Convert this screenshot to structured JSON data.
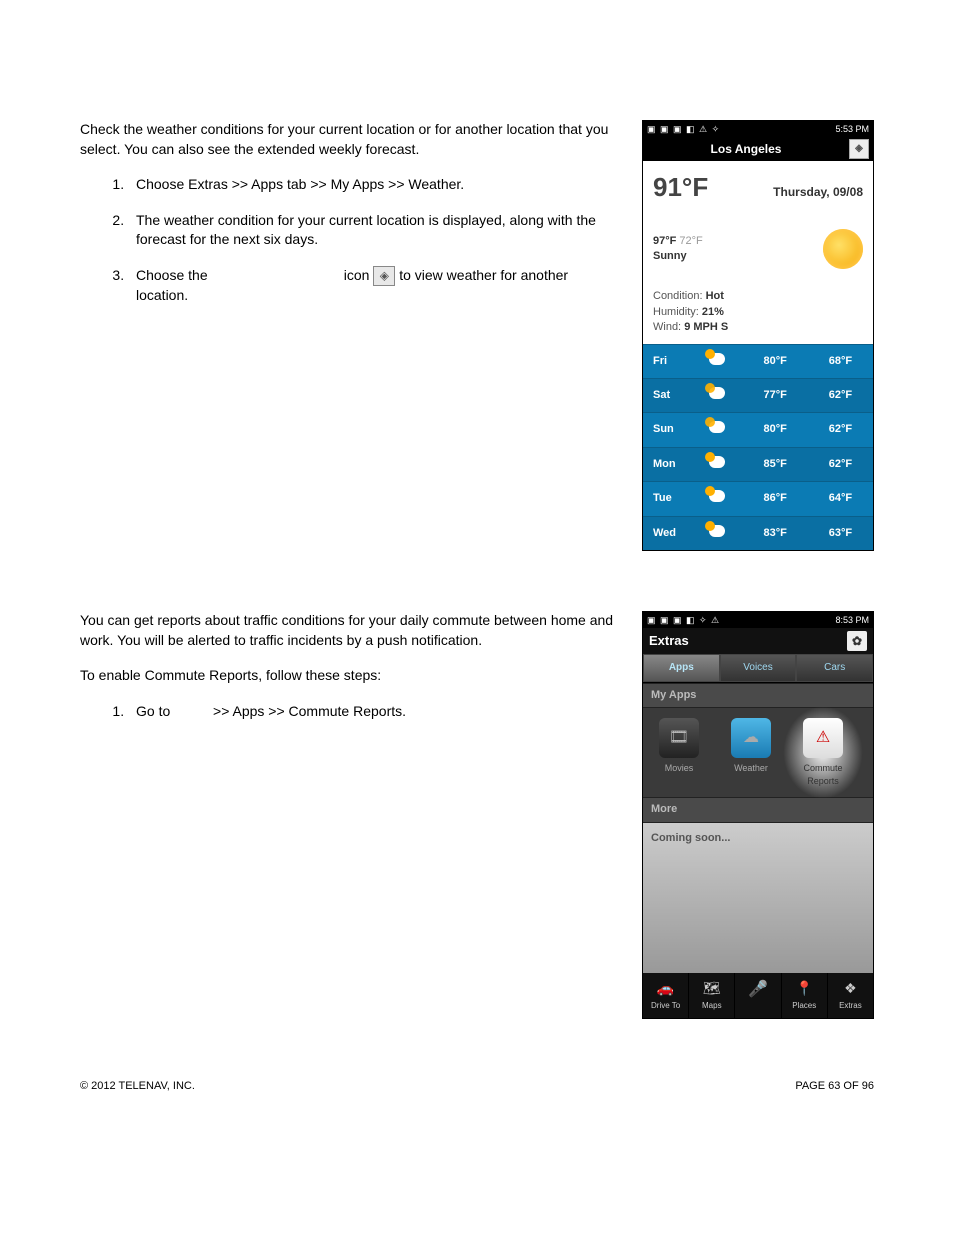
{
  "intro1": "Check the weather conditions for your current location or for another location that you select. You can also see the extended weekly forecast.",
  "steps1": [
    "Choose Extras >> Apps tab >> My Apps >> Weather.",
    "The weather condition for your current location is displayed, along with the forecast for the next six days."
  ],
  "step3_a": "Choose the",
  "step3_b": "icon",
  "step3_c": "to view weather for another location.",
  "phone1": {
    "time": "5:53 PM",
    "title": "Los Angeles",
    "temp": "91°F",
    "date": "Thursday, 09/08",
    "hi": "97°F",
    "lo": "72°F",
    "cond": "Sunny",
    "stat_cond_lbl": "Condition:",
    "stat_cond_val": "Hot",
    "stat_hum_lbl": "Humidity:",
    "stat_hum_val": "21%",
    "stat_wind_lbl": "Wind:",
    "stat_wind_val": "9 MPH S",
    "forecast": [
      {
        "day": "Fri",
        "hi": "80°F",
        "lo": "68°F"
      },
      {
        "day": "Sat",
        "hi": "77°F",
        "lo": "62°F"
      },
      {
        "day": "Sun",
        "hi": "80°F",
        "lo": "62°F"
      },
      {
        "day": "Mon",
        "hi": "85°F",
        "lo": "62°F"
      },
      {
        "day": "Tue",
        "hi": "86°F",
        "lo": "64°F"
      },
      {
        "day": "Wed",
        "hi": "83°F",
        "lo": "63°F"
      }
    ]
  },
  "intro2": "You can get reports about traffic conditions for your daily commute between home and work. You will be alerted to traffic incidents by a push notification.",
  "intro2b": "To enable Commute Reports, follow these steps:",
  "steps2": [
    "Go to           >> Apps >> Commute Reports."
  ],
  "phone2": {
    "time": "8:53 PM",
    "title": "Extras",
    "tabs": [
      "Apps",
      "Voices",
      "Cars"
    ],
    "sub1": "My Apps",
    "apps": [
      "Movies",
      "Weather",
      "Commute Reports"
    ],
    "sub2": "More",
    "coming": "Coming soon...",
    "nav": [
      "Drive To",
      "Maps",
      "",
      "Places",
      "Extras"
    ]
  },
  "footer_left": "© 2012 TELENAV, INC.",
  "footer_right": "PAGE 63 OF 96"
}
